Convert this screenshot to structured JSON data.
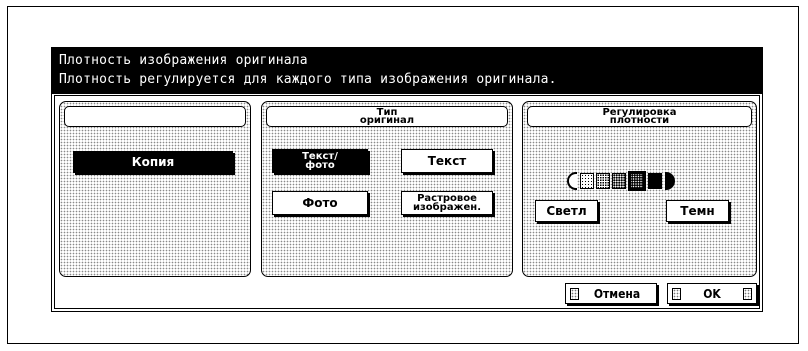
{
  "header": {
    "title": "Плотность изображения оригинала",
    "subtitle": "Плотность регулируется для каждого типа изображения оригинала."
  },
  "left_panel": {
    "copy_button": "Копия"
  },
  "original_type_panel": {
    "title_line1": "Тип",
    "title_line2": "оригинал",
    "options": {
      "text_photo_line1": "Текст/",
      "text_photo_line2": "фото",
      "text": "Текст",
      "photo": "Фото",
      "raster_line1": "Растровое",
      "raster_line2": "изображен."
    },
    "selected": "text_photo"
  },
  "density_panel": {
    "title_line1": "Регулировка",
    "title_line2": "плотности",
    "lighter_label": "Светл",
    "darker_label": "Темн",
    "levels": 5,
    "selected_level": 3
  },
  "footer": {
    "cancel_label": "Отмена",
    "ok_label": "OK"
  }
}
